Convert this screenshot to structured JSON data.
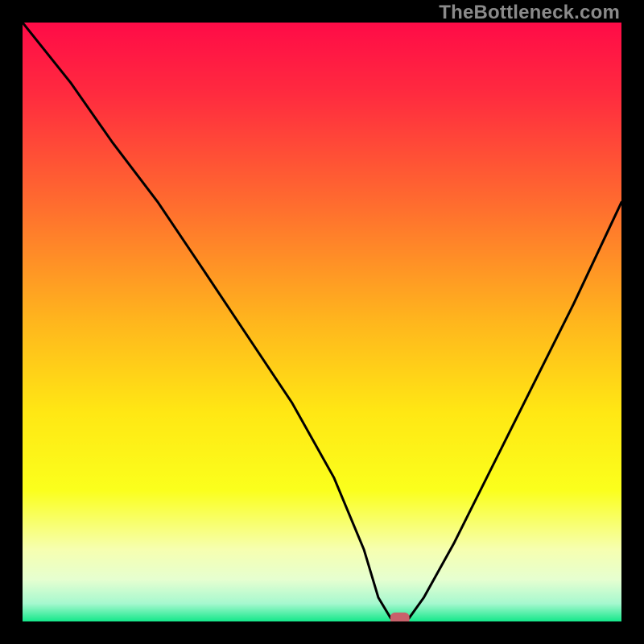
{
  "watermark": "TheBottleneck.com",
  "chart_data": {
    "type": "line",
    "title": "",
    "xlabel": "",
    "ylabel": "",
    "xlim": [
      0,
      100
    ],
    "ylim": [
      0,
      100
    ],
    "grid": false,
    "legend": false,
    "gradient_stops": [
      {
        "offset": 0.0,
        "color": "#ff0b47"
      },
      {
        "offset": 0.12,
        "color": "#ff2b3f"
      },
      {
        "offset": 0.3,
        "color": "#ff6b2f"
      },
      {
        "offset": 0.5,
        "color": "#ffb61d"
      },
      {
        "offset": 0.65,
        "color": "#ffe714"
      },
      {
        "offset": 0.78,
        "color": "#fbff1c"
      },
      {
        "offset": 0.88,
        "color": "#f6ffb0"
      },
      {
        "offset": 0.93,
        "color": "#e6ffd0"
      },
      {
        "offset": 0.97,
        "color": "#a6f8cf"
      },
      {
        "offset": 1.0,
        "color": "#14e88a"
      }
    ],
    "series": [
      {
        "name": "bottleneck-curve",
        "x": [
          0.0,
          8.0,
          15.0,
          22.6,
          30.0,
          38.0,
          45.0,
          52.0,
          57.0,
          59.4,
          61.5,
          64.5,
          67.0,
          72.0,
          78.0,
          85.0,
          92.0,
          100.0
        ],
        "y": [
          100.0,
          90.0,
          80.0,
          70.0,
          59.0,
          47.0,
          36.5,
          24.0,
          12.0,
          4.0,
          0.5,
          0.5,
          4.0,
          13.0,
          25.0,
          39.0,
          53.0,
          70.0
        ]
      }
    ],
    "marker": {
      "x": 63.0,
      "y": 0.5,
      "width": 3.2,
      "height": 2.0,
      "color": "#c9616b"
    }
  }
}
